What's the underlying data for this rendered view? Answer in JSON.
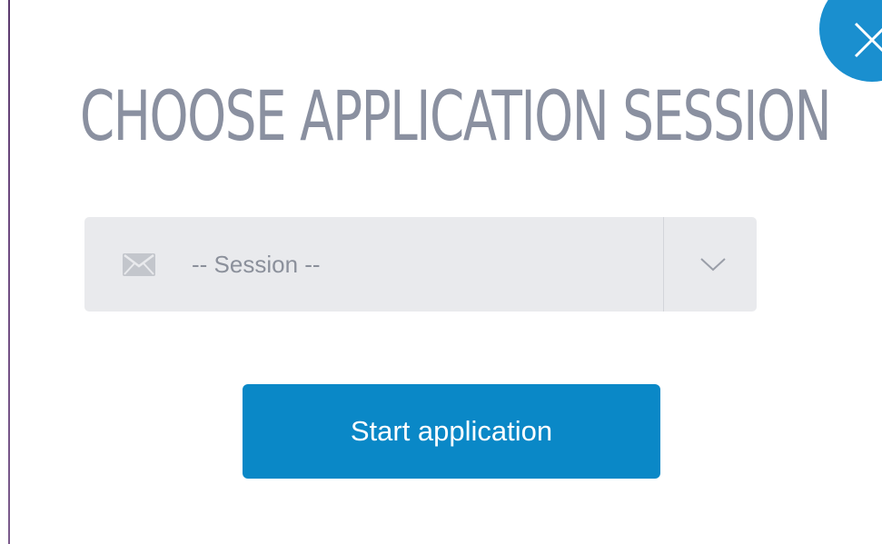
{
  "dialog": {
    "title": "CHOOSE APPLICATION SESSION",
    "close_icon": "close-icon"
  },
  "session_select": {
    "icon": "envelope-icon",
    "selected_value": "-- Session --",
    "dropdown_icon": "chevron-down-icon"
  },
  "actions": {
    "start_label": "Start application"
  },
  "colors": {
    "accent": "#0a88c7",
    "close_button": "#1a8fcf",
    "title_text": "#8a90a0",
    "select_background": "#e9eaed"
  }
}
